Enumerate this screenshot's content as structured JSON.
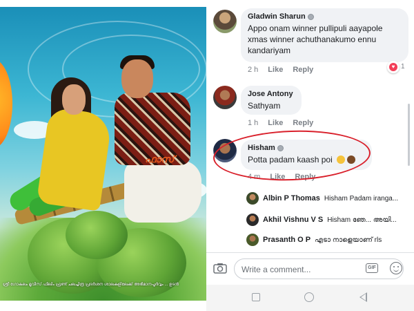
{
  "poster": {
    "malayalam_text": "ഫാസ്",
    "bottom_strip": "ശ്രീ ഗോകുലം മൂവീസ് ഫിലിം ഫ്രണ്ട് ചലച്ചിത്ര പ്രദർശന ശാലകളിലേക്ക് അഭിമാനപൂർവ്വം ... ഉടൻ"
  },
  "comments": [
    {
      "author": "Gladwin Sharun",
      "text_lines": [
        "Appo onam winner pullipuli aayapole",
        "xmas winner achuthanakumo ennu",
        "kandariyam"
      ],
      "time": "2 h",
      "like": "Like",
      "reply": "Reply",
      "reaction_count": "1"
    },
    {
      "author": "Jose Antony",
      "text_lines": [
        "Sathyam"
      ],
      "time": "1 h",
      "like": "Like",
      "reply": "Reply"
    },
    {
      "author": "Hisham",
      "text_lines": [
        "Potta padam kaash poi"
      ],
      "time": "4 m",
      "like": "Like",
      "reply": "Reply"
    }
  ],
  "replies": [
    {
      "author": "Albin P Thomas",
      "text": "Hisham Padam iranga..."
    },
    {
      "author": "Akhil Vishnu V S",
      "text": "Hisham ഞേ... അയി..."
    },
    {
      "author": "Prasanth O P",
      "text": "എടാ നാളെയാണ് rls"
    }
  ],
  "composer": {
    "placeholder": "Write a comment...",
    "gif_label": "GIF"
  },
  "colors": {
    "annotation_circle": "#d9202b",
    "bubble_bg": "#f0f2f5"
  }
}
